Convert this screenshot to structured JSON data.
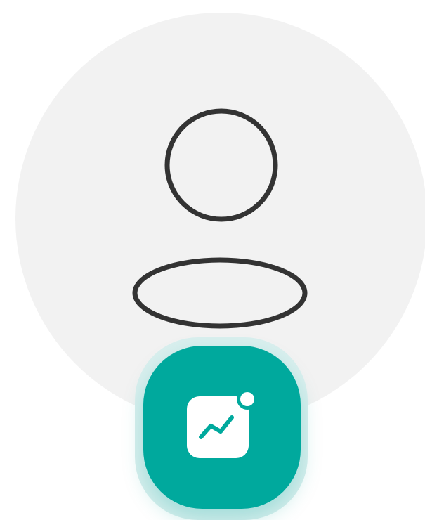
{
  "avatar": {
    "icon": "person-outline-icon",
    "background_color": "#f2f2f2",
    "stroke_color": "#333333"
  },
  "badge": {
    "icon": "activity-chart-notification-icon",
    "color": "#00a99d",
    "glow_color": "#d9efee",
    "has_notification_dot": true
  }
}
